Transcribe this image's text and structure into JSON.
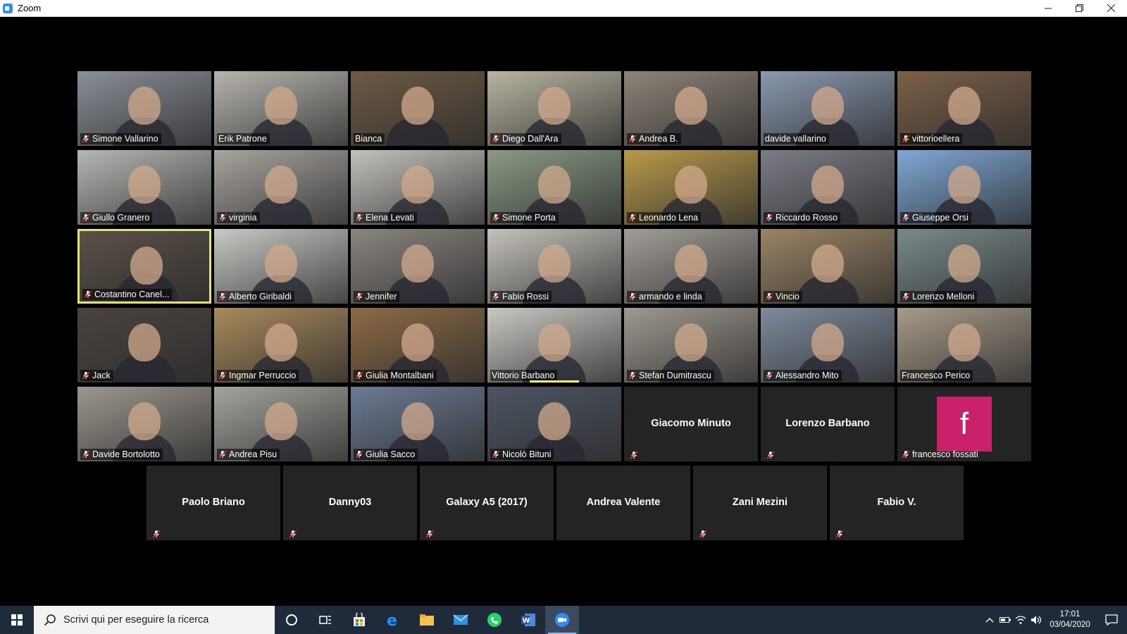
{
  "window": {
    "title": "Zoom"
  },
  "participants": [
    {
      "name": "Simone Vallarino",
      "muted": true,
      "video": true,
      "bg": "#8a8f97"
    },
    {
      "name": "Erik Patrone",
      "muted": false,
      "video": true,
      "bg": "#b7b4ae"
    },
    {
      "name": "Bianca",
      "muted": false,
      "video": true,
      "bg": "#6d5a45"
    },
    {
      "name": "Diego Dall'Ara",
      "muted": true,
      "video": true,
      "bg": "#b9b4a2"
    },
    {
      "name": "Andrea B.",
      "muted": true,
      "video": true,
      "bg": "#8e8378"
    },
    {
      "name": "davide vallarino",
      "muted": false,
      "video": true,
      "bg": "#8a99b0"
    },
    {
      "name": "vittorioellera",
      "muted": true,
      "video": true,
      "bg": "#7b6048"
    },
    {
      "name": "Giullo Granero",
      "muted": true,
      "video": true,
      "bg": "#b5b7b3"
    },
    {
      "name": "virginia",
      "muted": true,
      "video": true,
      "bg": "#a8a49f"
    },
    {
      "name": "Elena Levati",
      "muted": true,
      "video": true,
      "bg": "#c2c1bc"
    },
    {
      "name": "Simone Porta",
      "muted": true,
      "video": true,
      "bg": "#8a9a84"
    },
    {
      "name": "Leonardo Lena",
      "muted": true,
      "video": true,
      "bg": "#b99a4a"
    },
    {
      "name": "Riccardo Rosso",
      "muted": true,
      "video": true,
      "bg": "#7b7d86"
    },
    {
      "name": "Giuseppe Orsi",
      "muted": true,
      "video": true,
      "bg": "#7fa8d6"
    },
    {
      "name": "Costantino Canel...",
      "muted": true,
      "video": true,
      "bg": "#5a5048",
      "active": true
    },
    {
      "name": "Alberto Giribaldi",
      "muted": true,
      "video": true,
      "bg": "#c8c9c4"
    },
    {
      "name": "Jennifer",
      "muted": true,
      "video": true,
      "bg": "#8a8580"
    },
    {
      "name": "Fabio Rossi",
      "muted": true,
      "video": true,
      "bg": "#c5c2bc"
    },
    {
      "name": "armando e linda",
      "muted": true,
      "video": true,
      "bg": "#a29d97"
    },
    {
      "name": "Vincio",
      "muted": true,
      "video": true,
      "bg": "#9a8464"
    },
    {
      "name": "Lorenzo Melloni",
      "muted": true,
      "video": true,
      "bg": "#7a8a8c"
    },
    {
      "name": "Jack",
      "muted": true,
      "video": true,
      "bg": "#4a4440"
    },
    {
      "name": "Ingmar Perruccio",
      "muted": true,
      "video": true,
      "bg": "#a98a5c"
    },
    {
      "name": "Giulia Montalbani",
      "muted": true,
      "video": true,
      "bg": "#8d6a45"
    },
    {
      "name": "Vittorio Barbano",
      "muted": false,
      "video": true,
      "bg": "#c9c8c4",
      "speaking": true
    },
    {
      "name": "Stefan Dumitrascu",
      "muted": true,
      "video": true,
      "bg": "#9e9890"
    },
    {
      "name": "Alessandro Mito",
      "muted": true,
      "video": true,
      "bg": "#7d8b9c"
    },
    {
      "name": "Francesco Perico",
      "muted": false,
      "video": true,
      "bg": "#a79b8a"
    },
    {
      "name": "Davide Bortolotto",
      "muted": true,
      "video": true,
      "bg": "#9c978f"
    },
    {
      "name": "Andrea Pisu",
      "muted": true,
      "video": true,
      "bg": "#a3a39e"
    },
    {
      "name": "Giulia Sacco",
      "muted": true,
      "video": true,
      "bg": "#6c7a94"
    },
    {
      "name": "Nicolò Bituni",
      "muted": true,
      "video": true,
      "bg": "#4d5563"
    },
    {
      "name": "Giacomo Minuto",
      "muted": true,
      "video": false
    },
    {
      "name": "Lorenzo Barbano",
      "muted": true,
      "video": false
    },
    {
      "name": "francesco fossati",
      "muted": true,
      "video": false,
      "avatar_letter": "f",
      "avatar_color": "#c9216a"
    },
    {
      "name": "Paolo Briano",
      "muted": true,
      "video": false
    },
    {
      "name": "Danny03",
      "muted": true,
      "video": false
    },
    {
      "name": "Galaxy A5 (2017)",
      "muted": true,
      "video": false
    },
    {
      "name": "Andrea Valente",
      "muted": false,
      "video": false
    },
    {
      "name": "Zani Mezini",
      "muted": true,
      "video": false
    },
    {
      "name": "Fabio V.",
      "muted": true,
      "video": false
    }
  ],
  "taskbar": {
    "search_placeholder": "Scrivi qui per eseguire la ricerca",
    "apps": [
      "task-view-icon",
      "store-icon",
      "edge-icon",
      "file-explorer-icon",
      "mail-icon",
      "whatsapp-icon",
      "word-icon",
      "zoom-icon"
    ],
    "time": "17:01",
    "date": "03/04/2020"
  },
  "colors": {
    "active_speaker_border": "#e3e37a",
    "avatar": "#c9216a",
    "taskbar": "#1f2a3a"
  }
}
